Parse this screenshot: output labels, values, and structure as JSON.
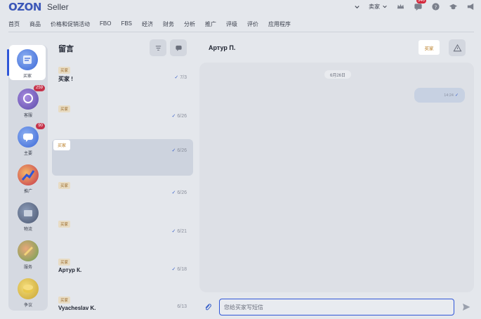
{
  "header": {
    "logo": "OZON",
    "logo_sub": "Seller",
    "seller_label": "卖家",
    "notifications_count": "340"
  },
  "nav": [
    "首页",
    "商品",
    "价格和促销活动",
    "FBO",
    "FBS",
    "经济",
    "财务",
    "分析",
    "推广",
    "评级",
    "评价",
    "应用程序"
  ],
  "rail": [
    {
      "label": "买家",
      "badge": "",
      "icon": "buyer-icon",
      "active": true
    },
    {
      "label": "客服",
      "badge": "259",
      "icon": "support-icon"
    },
    {
      "label": "主要",
      "badge": "90",
      "icon": "main-chat-icon"
    },
    {
      "label": "推广",
      "badge": "",
      "icon": "promotion-icon"
    },
    {
      "label": "物流",
      "badge": "",
      "icon": "logistics-icon"
    },
    {
      "label": "服务",
      "badge": "",
      "icon": "services-icon"
    },
    {
      "label": "争议",
      "badge": "",
      "icon": "disputes-icon"
    }
  ],
  "list": {
    "title": "留言",
    "conversations": [
      {
        "tag": "买家",
        "name": "买家 !",
        "date": "7/3",
        "checked": true
      },
      {
        "tag": "买家",
        "name": "",
        "date": "6/26",
        "checked": true
      },
      {
        "tag": "买家",
        "name": "",
        "date": "6/26",
        "checked": true,
        "selected": true
      },
      {
        "tag": "买家",
        "name": "",
        "date": "6/26",
        "checked": true
      },
      {
        "tag": "买家",
        "name": "",
        "date": "6/21",
        "checked": true
      },
      {
        "tag": "买家",
        "name": "Артур К.",
        "date": "6/18",
        "checked": true
      },
      {
        "tag": "买家",
        "name": "Vyacheslav K.",
        "date": "6/13",
        "checked": false
      }
    ]
  },
  "chat": {
    "name": "Артур П.",
    "tag": "买家",
    "date_chip": "6月26日",
    "message_time": "14:24",
    "input_placeholder": "您给买家写短信"
  },
  "colors": {
    "accent": "#2f56d8",
    "badge": "#c5324a",
    "tag_text": "#b87a1f"
  }
}
